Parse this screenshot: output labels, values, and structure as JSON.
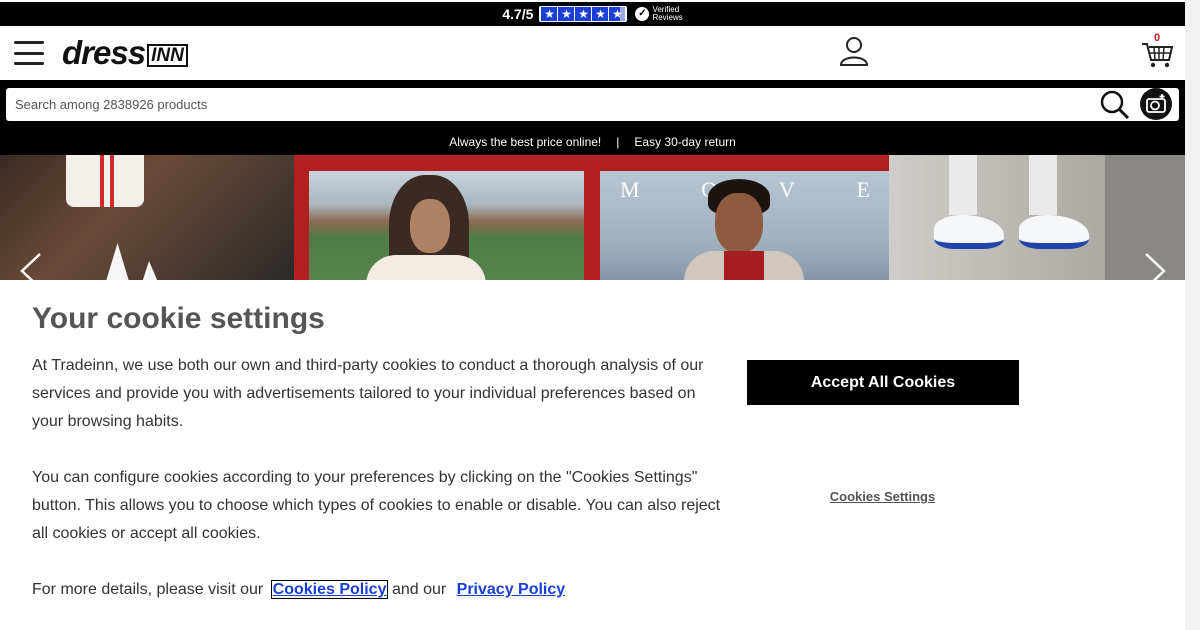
{
  "topbar": {
    "rating": "4.7/5",
    "stars": 4.7,
    "verified_line1": "Verified",
    "verified_line2": "Reviews"
  },
  "header": {
    "logo_dress": "dress",
    "logo_inn": "INN",
    "cart_count": "0"
  },
  "search": {
    "placeholder": "Search among 2838926 products"
  },
  "promo": {
    "item1": "Always the best price online!",
    "separator": "|",
    "item2": "Easy 30-day return"
  },
  "banner": {
    "letters": [
      "M",
      "O",
      "V",
      "E"
    ]
  },
  "cookies": {
    "title": "Your cookie settings",
    "paragraph1": "At Tradeinn, we use both our own and third-party cookies to conduct a thorough analysis of our services and provide you with advertisements tailored to your individual preferences based on your browsing habits.",
    "paragraph2": "You can configure cookies according to your preferences by clicking on the \"Cookies Settings\" button. This allows you to choose which types of cookies to enable or disable. You can also reject all cookies or accept all cookies.",
    "paragraph3_prefix": "For more details, please visit our",
    "cookies_policy_link": "Cookies Policy",
    "paragraph3_middle": "and our",
    "privacy_policy_link": "Privacy Policy",
    "accept_label": "Accept All Cookies",
    "settings_label": "Cookies Settings"
  },
  "colors": {
    "brand_red": "#b1201f",
    "link_blue": "#1a3fd6",
    "star_blue": "#1a3fd6"
  }
}
